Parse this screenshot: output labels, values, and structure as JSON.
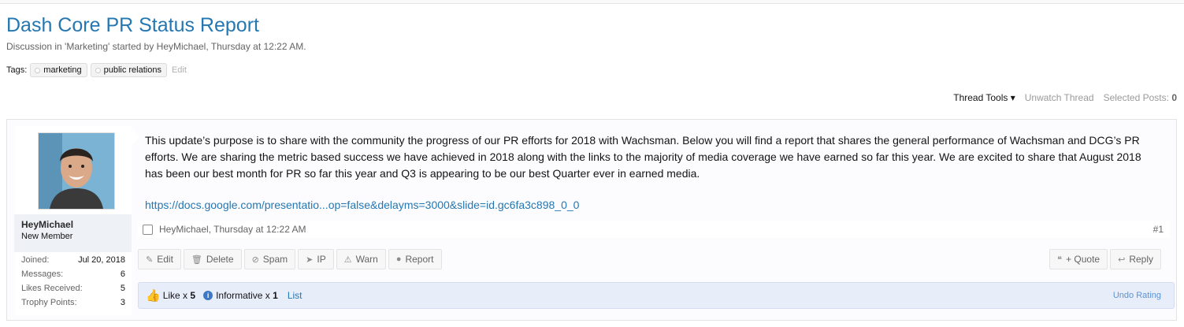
{
  "thread": {
    "title": "Dash Core PR Status Report",
    "meta": "Discussion in 'Marketing' started by HeyMichael, Thursday at 12:22 AM.",
    "tags_label": "Tags:",
    "tags": [
      "marketing",
      "public relations"
    ],
    "tags_edit": "Edit"
  },
  "tools": {
    "thread_tools": "Thread Tools ▾",
    "unwatch": "Unwatch Thread",
    "selected_posts_label": "Selected Posts:",
    "selected_posts_count": "0"
  },
  "user": {
    "name": "HeyMichael",
    "title": "New Member",
    "stats": [
      {
        "label": "Joined:",
        "value": "Jul 20, 2018"
      },
      {
        "label": "Messages:",
        "value": "6"
      },
      {
        "label": "Likes Received:",
        "value": "5"
      },
      {
        "label": "Trophy Points:",
        "value": "3"
      }
    ]
  },
  "post": {
    "body": "This update’s purpose is to share with the community the progress of our PR efforts for 2018 with Wachsman. Below you will find a report that shares the general performance of Wachsman and DCG’s PR efforts. We are sharing the metric based success we have achieved in 2018 along with the links to the majority of media coverage we have earned so far this year. We are excited to share that August 2018 has been our best month for PR so far this year and Q3 is appearing to be our best Quarter ever in earned media.",
    "link": "https://docs.google.com/presentatio...op=false&delayms=3000&slide=id.gc6fa3c898_0_0",
    "author_time": "HeyMichael, Thursday at 12:22 AM",
    "number": "#1"
  },
  "controls": {
    "edit": "Edit",
    "delete": "Delete",
    "spam": "Spam",
    "ip": "IP",
    "warn": "Warn",
    "report": "Report",
    "quote": "+ Quote",
    "reply": "Reply"
  },
  "ratings": {
    "like_label": "Like x",
    "like_count": "5",
    "informative_label": "Informative x",
    "informative_count": "1",
    "list": "List",
    "undo": "Undo Rating"
  }
}
